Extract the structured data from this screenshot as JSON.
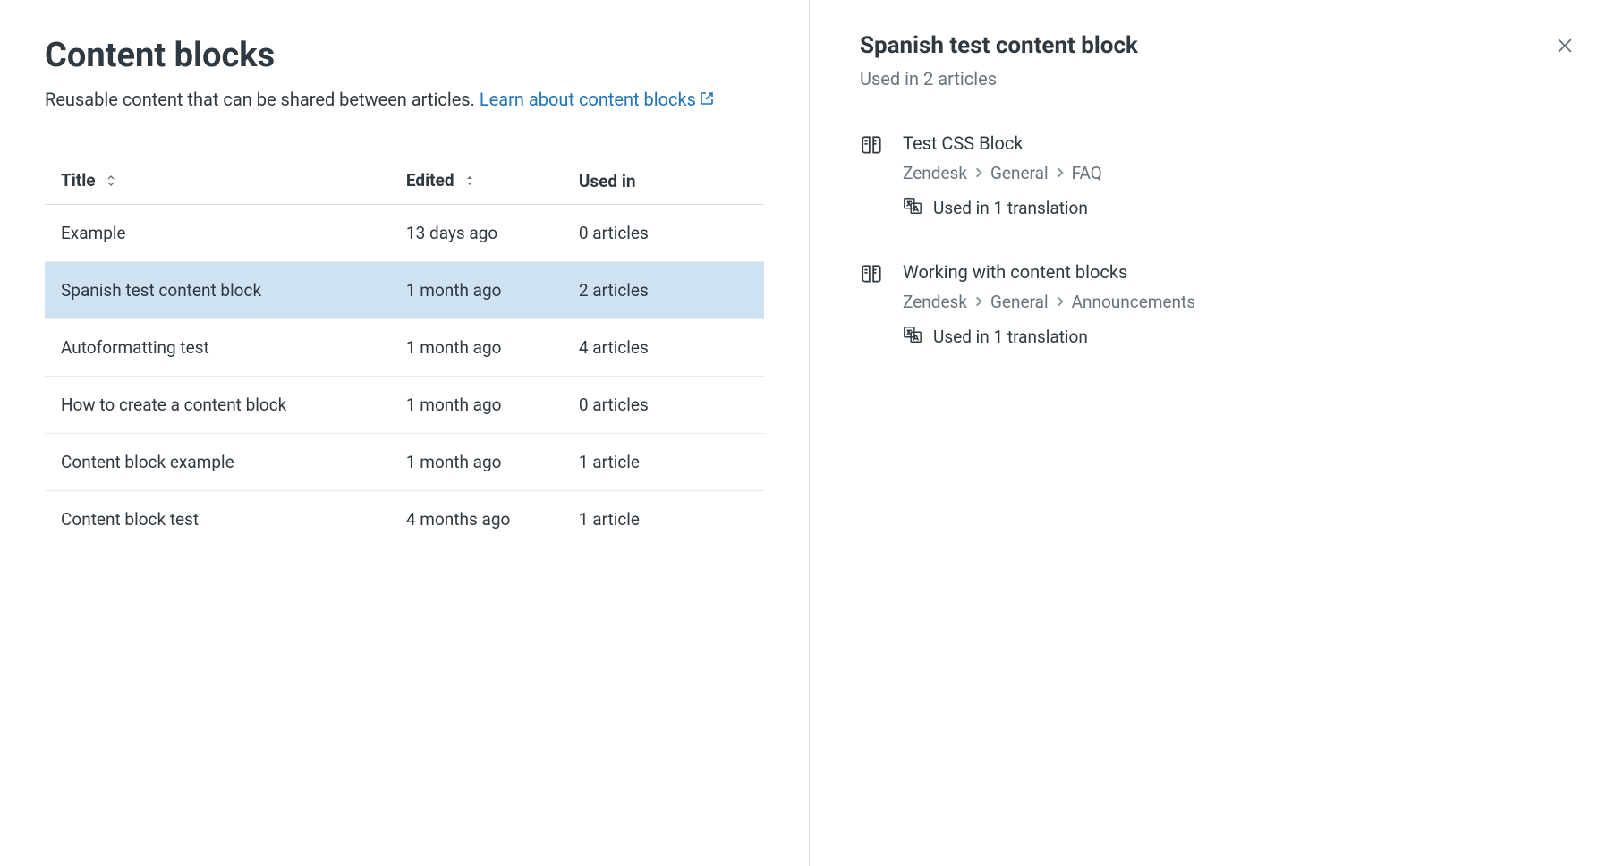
{
  "page": {
    "title": "Content blocks",
    "subtitle_prefix": "Reusable content that can be shared between articles. ",
    "learn_link": "Learn about content blocks"
  },
  "table": {
    "headers": {
      "title": "Title",
      "edited": "Edited",
      "used_in": "Used in"
    },
    "rows": [
      {
        "title": "Example",
        "edited": "13 days ago",
        "used_in": "0 articles",
        "selected": false
      },
      {
        "title": "Spanish test content block",
        "edited": "1 month ago",
        "used_in": "2 articles",
        "selected": true
      },
      {
        "title": "Autoformatting test",
        "edited": "1 month ago",
        "used_in": "4 articles",
        "selected": false
      },
      {
        "title": "How to create a content block",
        "edited": "1 month ago",
        "used_in": "0 articles",
        "selected": false
      },
      {
        "title": "Content block example",
        "edited": "1 month ago",
        "used_in": "1 article",
        "selected": false
      },
      {
        "title": "Content block test",
        "edited": "4 months ago",
        "used_in": "1 article",
        "selected": false
      }
    ]
  },
  "detail": {
    "title": "Spanish test content block",
    "subtitle": "Used in 2 articles",
    "usages": [
      {
        "title": "Test CSS Block",
        "breadcrumb": [
          "Zendesk",
          "General",
          "FAQ"
        ],
        "translations": "Used in 1 translation"
      },
      {
        "title": "Working with content blocks",
        "breadcrumb": [
          "Zendesk",
          "General",
          "Announcements"
        ],
        "translations": "Used in 1 translation"
      }
    ]
  }
}
